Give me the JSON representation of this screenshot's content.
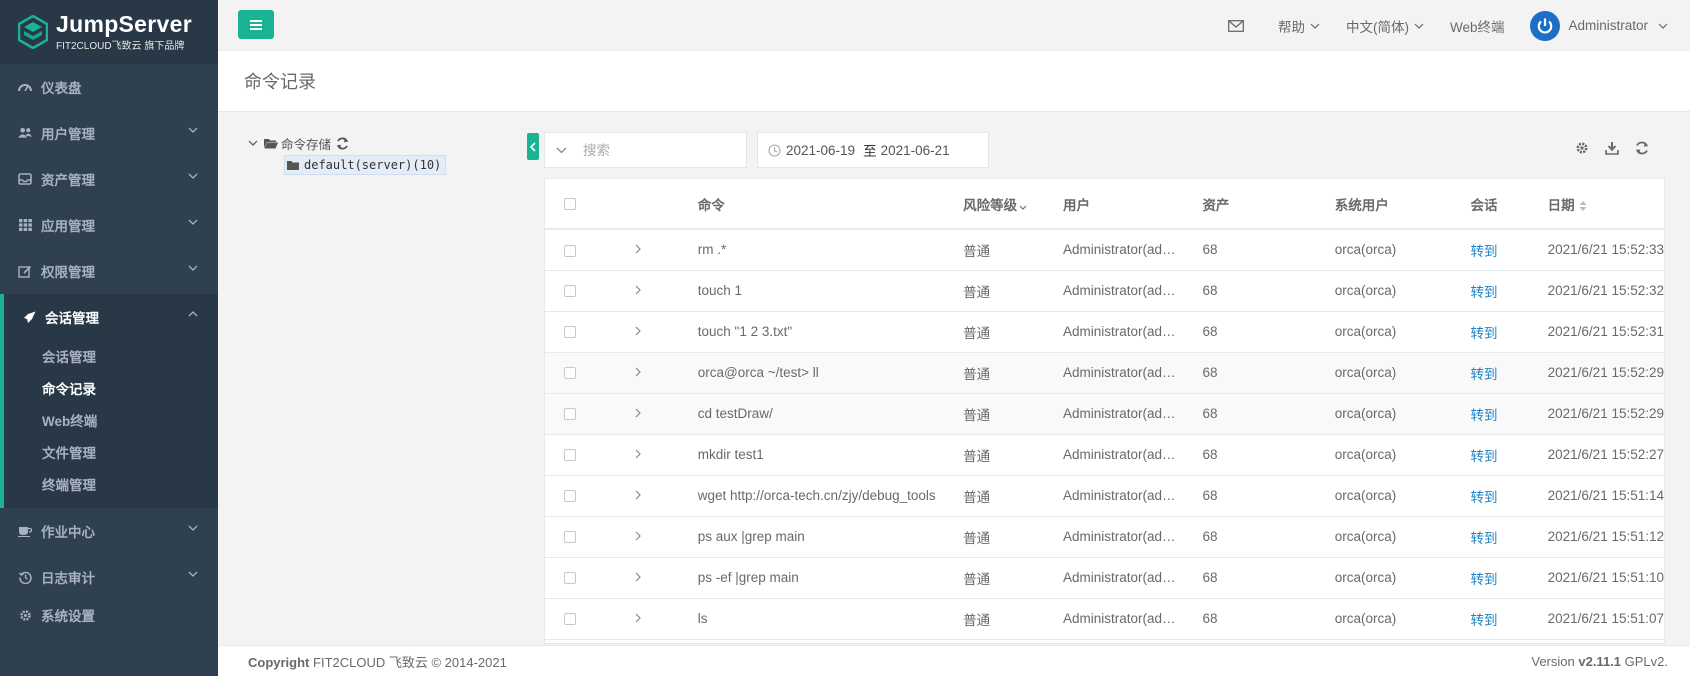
{
  "brand": {
    "title": "JumpServer",
    "subtitle": "FIT2CLOUD飞致云 旗下品牌"
  },
  "sidebar": {
    "items": [
      {
        "label": "仪表盘",
        "icon": "dashboard-icon"
      },
      {
        "label": "用户管理",
        "icon": "users-icon"
      },
      {
        "label": "资产管理",
        "icon": "inbox-icon"
      },
      {
        "label": "应用管理",
        "icon": "grid-icon"
      },
      {
        "label": "权限管理",
        "icon": "edit-icon"
      }
    ],
    "active_group": {
      "label": "会话管理",
      "icon": "rocket-icon",
      "children": [
        "会话管理",
        "命令记录",
        "Web终端",
        "文件管理",
        "终端管理"
      ],
      "active_child": "命令记录"
    },
    "bottom_items": [
      {
        "label": "作业中心",
        "icon": "coffee-icon"
      },
      {
        "label": "日志审计",
        "icon": "history-icon"
      },
      {
        "label": "系统设置",
        "icon": "gear-icon"
      }
    ]
  },
  "topbar": {
    "help": "帮助",
    "language": "中文(简体)",
    "web_terminal": "Web终端",
    "user": "Administrator"
  },
  "page": {
    "title": "命令记录"
  },
  "tree": {
    "root": "命令存储",
    "child": "default(server)(10)"
  },
  "toolbar": {
    "search_placeholder": "搜索",
    "date_from": "2021-06-19",
    "date_sep": "至",
    "date_to": "2021-06-21"
  },
  "table": {
    "headers": {
      "command": "命令",
      "risk": "风险等级",
      "user": "用户",
      "asset": "资产",
      "system_user": "系统用户",
      "session": "会话",
      "date": "日期"
    },
    "rows": [
      {
        "command": "rm .*",
        "risk": "普通",
        "user": "Administrator(ad…",
        "asset": "68",
        "system_user": "orca(orca)",
        "session": "转到",
        "date": "2021/6/21 15:52:33"
      },
      {
        "command": "touch 1",
        "risk": "普通",
        "user": "Administrator(ad…",
        "asset": "68",
        "system_user": "orca(orca)",
        "session": "转到",
        "date": "2021/6/21 15:52:32"
      },
      {
        "command": "touch \"1 2 3.txt\"",
        "risk": "普通",
        "user": "Administrator(ad…",
        "asset": "68",
        "system_user": "orca(orca)",
        "session": "转到",
        "date": "2021/6/21 15:52:31"
      },
      {
        "command": "orca@orca ~/test> ll",
        "risk": "普通",
        "user": "Administrator(ad…",
        "asset": "68",
        "system_user": "orca(orca)",
        "session": "转到",
        "date": "2021/6/21 15:52:29"
      },
      {
        "command": "cd testDraw/",
        "risk": "普通",
        "user": "Administrator(ad…",
        "asset": "68",
        "system_user": "orca(orca)",
        "session": "转到",
        "date": "2021/6/21 15:52:29"
      },
      {
        "command": "mkdir test1",
        "risk": "普通",
        "user": "Administrator(ad…",
        "asset": "68",
        "system_user": "orca(orca)",
        "session": "转到",
        "date": "2021/6/21 15:52:27"
      },
      {
        "command": "wget http://orca-tech.cn/zjy/debug_tools",
        "risk": "普通",
        "user": "Administrator(ad…",
        "asset": "68",
        "system_user": "orca(orca)",
        "session": "转到",
        "date": "2021/6/21 15:51:14"
      },
      {
        "command": "ps aux |grep main",
        "risk": "普通",
        "user": "Administrator(ad…",
        "asset": "68",
        "system_user": "orca(orca)",
        "session": "转到",
        "date": "2021/6/21 15:51:12"
      },
      {
        "command": "ps -ef |grep main",
        "risk": "普通",
        "user": "Administrator(ad…",
        "asset": "68",
        "system_user": "orca(orca)",
        "session": "转到",
        "date": "2021/6/21 15:51:10"
      },
      {
        "command": "ls",
        "risk": "普通",
        "user": "Administrator(ad…",
        "asset": "68",
        "system_user": "orca(orca)",
        "session": "转到",
        "date": "2021/6/21 15:51:07"
      }
    ]
  },
  "footer": {
    "copyright_label": "Copyright",
    "copyright_text": "FIT2CLOUD 飞致云 © 2014-2021",
    "version_label": "Version",
    "version": "v2.11.1",
    "license": "GPLv2."
  },
  "colors": {
    "accent": "#1ab394",
    "sidebar_bg": "#2f4050",
    "link": "#1c84c6"
  }
}
